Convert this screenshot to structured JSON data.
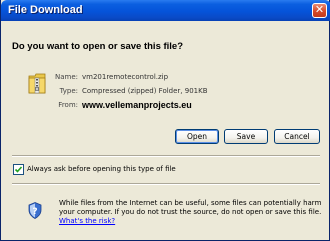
{
  "window": {
    "title": "File Download"
  },
  "dialog": {
    "question": "Do you want to open or save this file?",
    "file": {
      "name_label": "Name:",
      "name_value": "vm201remotecontrol.zip",
      "type_label": "Type:",
      "type_value": "Compressed (zipped) Folder, 901KB",
      "from_label": "From:",
      "from_value": "www.vellemanprojects.eu"
    },
    "buttons": {
      "open": "Open",
      "save": "Save",
      "cancel": "Cancel"
    },
    "checkbox": {
      "label": "Always ask before opening this type of file",
      "checked": true
    },
    "warning": {
      "text": "While files from the Internet can be useful, some files can potentially harm your computer. If you do not trust the source, do not open or save this file.",
      "link": "What's the risk?"
    }
  },
  "icons": {
    "close": "close-icon",
    "file": "zip-folder-icon",
    "check": "checkmark-icon",
    "shield": "security-shield-icon"
  },
  "colors": {
    "titlebar": "#0553d9",
    "dialog_bg": "#ece9d8",
    "link": "#0000ff"
  }
}
